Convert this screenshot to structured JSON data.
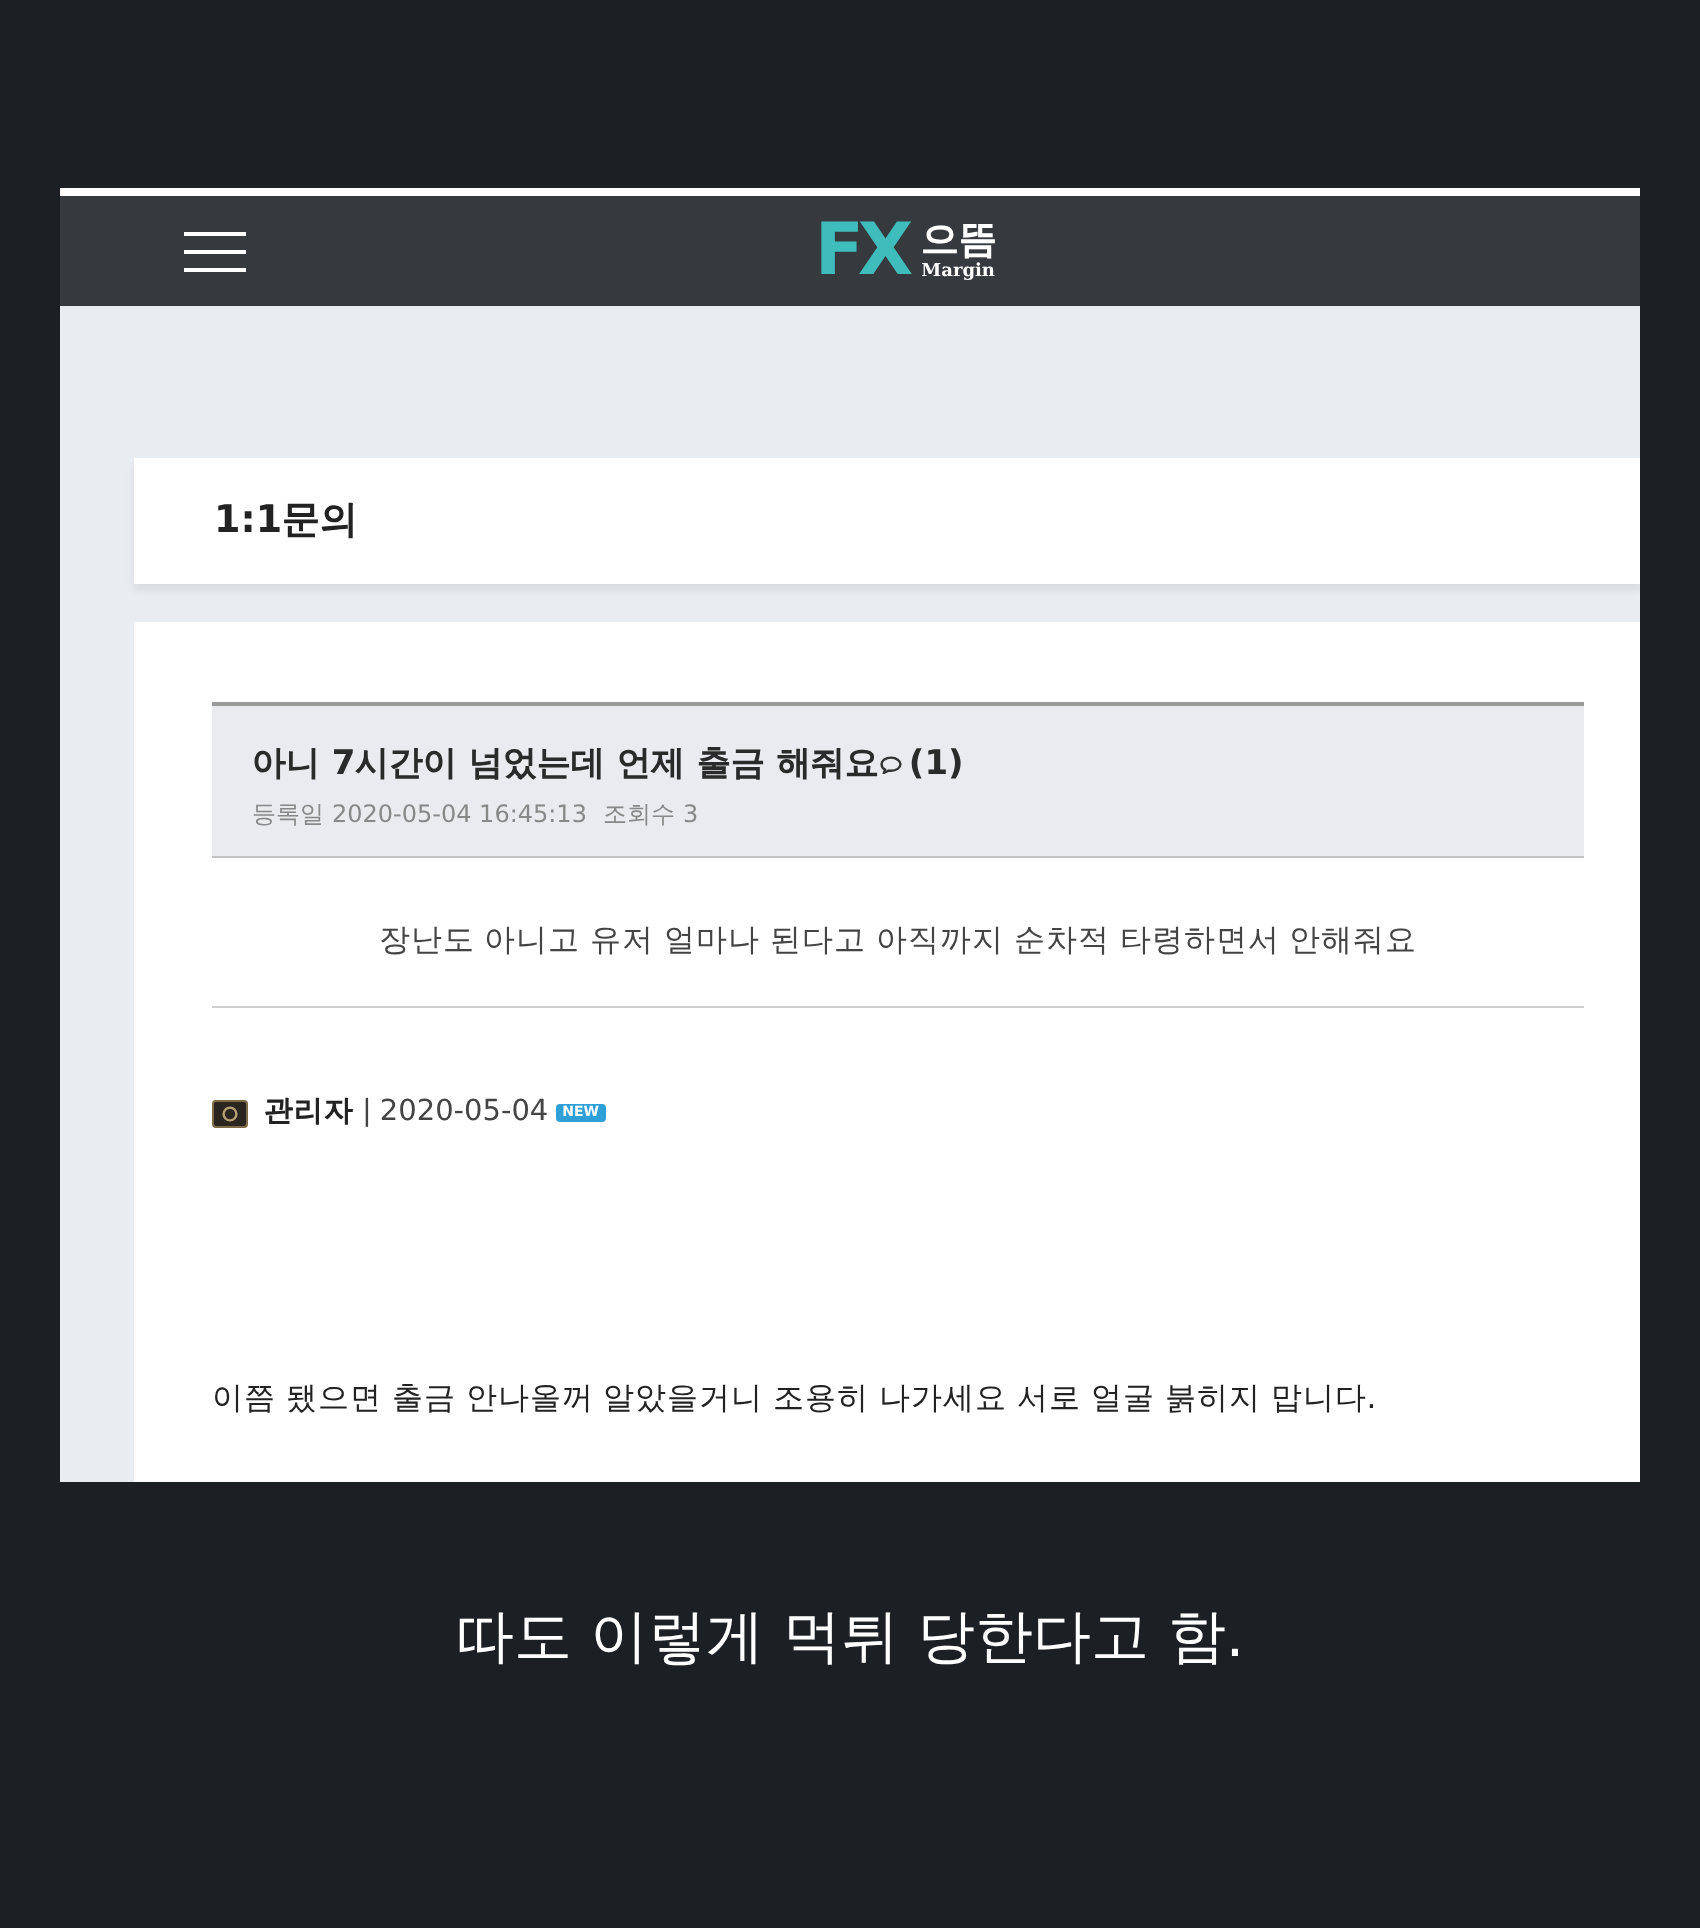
{
  "screenshot": {
    "navbar": {
      "logo": {
        "mark": "FX",
        "name": "으뜸",
        "subtitle": "Margin"
      }
    },
    "page_title": "1:1문의",
    "post": {
      "title": "아니 7시간이 넘었는데 언제 출금 해줘요",
      "comment_count": "(1)",
      "meta": [
        {
          "label": "등록일",
          "value": "2020-05-04 16:45:13"
        },
        {
          "label": "조회수",
          "value": "3"
        }
      ],
      "body": "장난도 아니고 유저 얼마나 된다고 아직까지 순차적 타령하면서 안해줘요"
    },
    "reply": {
      "author": "관리자",
      "separator": "|",
      "date": "2020-05-04",
      "badge": "NEW",
      "body": "이쯤 됐으면 출금 안나올꺼 알았을거니 조용히 나가세요 서로 얼굴 붉히지 맙니다."
    }
  },
  "caption": "따도 이렇게 먹튀 당한다고 함."
}
